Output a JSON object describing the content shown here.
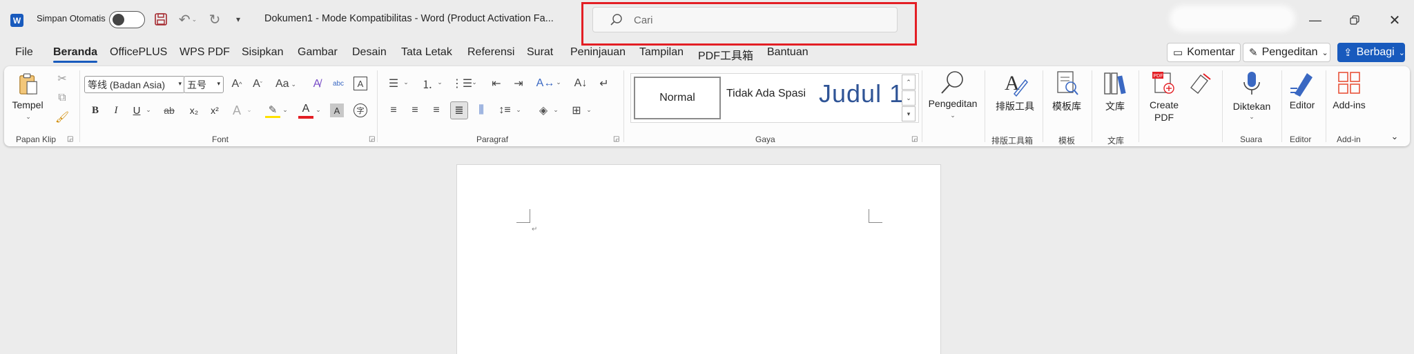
{
  "titlebar": {
    "app_logo": "W",
    "autosave_label": "Simpan Otomatis",
    "autosave_on": false,
    "doc_title": "Dokumen1  -  Mode Kompatibilitas  -  Word (Product Activation Fa...",
    "search_placeholder": "Cari",
    "highlight_color": "#e31e24",
    "icons": [
      "word-logo-icon",
      "save-icon",
      "undo-icon",
      "redo-icon",
      "customize-icon",
      "search-icon",
      "minimize-icon",
      "restore-icon",
      "close-icon"
    ]
  },
  "tabs": [
    "File",
    "Beranda",
    "OfficePLUS",
    "WPS PDF",
    "Sisipkan",
    "Gambar",
    "Desain",
    "Tata Letak",
    "Referensi",
    "Surat",
    "Peninjauan",
    "Tampilan",
    "PDF工具箱",
    "Bantuan"
  ],
  "active_tab": "Beranda",
  "header_buttons": {
    "comment": "Komentar",
    "editing": "Pengeditan",
    "share": "Berbagi"
  },
  "ribbon": {
    "clipboard": {
      "paste": "Tempel",
      "group": "Papan Klip"
    },
    "font": {
      "name": "等线 (Badan Asia)",
      "size": "五号",
      "group": "Font",
      "change_case": "Aa",
      "bold": "B",
      "italic": "I",
      "underline": "U",
      "strike": "ab",
      "subscript": "x₂",
      "superscript": "x²",
      "font_color_mark": "A",
      "font_color": "#e31e24"
    },
    "paragraph": {
      "group": "Paragraf"
    },
    "styles": {
      "normal": "Normal",
      "no_spacing": "Tidak Ada Spasi",
      "heading1": "Judul 1",
      "group": "Gaya"
    },
    "editing": {
      "label": "Pengeditan"
    },
    "layout_tool": {
      "label": "排版工具",
      "group": "排版工具箱"
    },
    "template": {
      "label": "模板库",
      "group": "模板"
    },
    "library": {
      "label": "文库",
      "group": "文库"
    },
    "create_pdf": {
      "label_line1": "Create",
      "label_line2": "PDF"
    },
    "dictate": {
      "label": "Diktekan",
      "group": "Suara"
    },
    "editor": {
      "label": "Editor",
      "group": "Editor"
    },
    "addins": {
      "label": "Add-ins",
      "group": "Add-in"
    }
  },
  "page": {
    "paragraph_mark": "↵"
  }
}
